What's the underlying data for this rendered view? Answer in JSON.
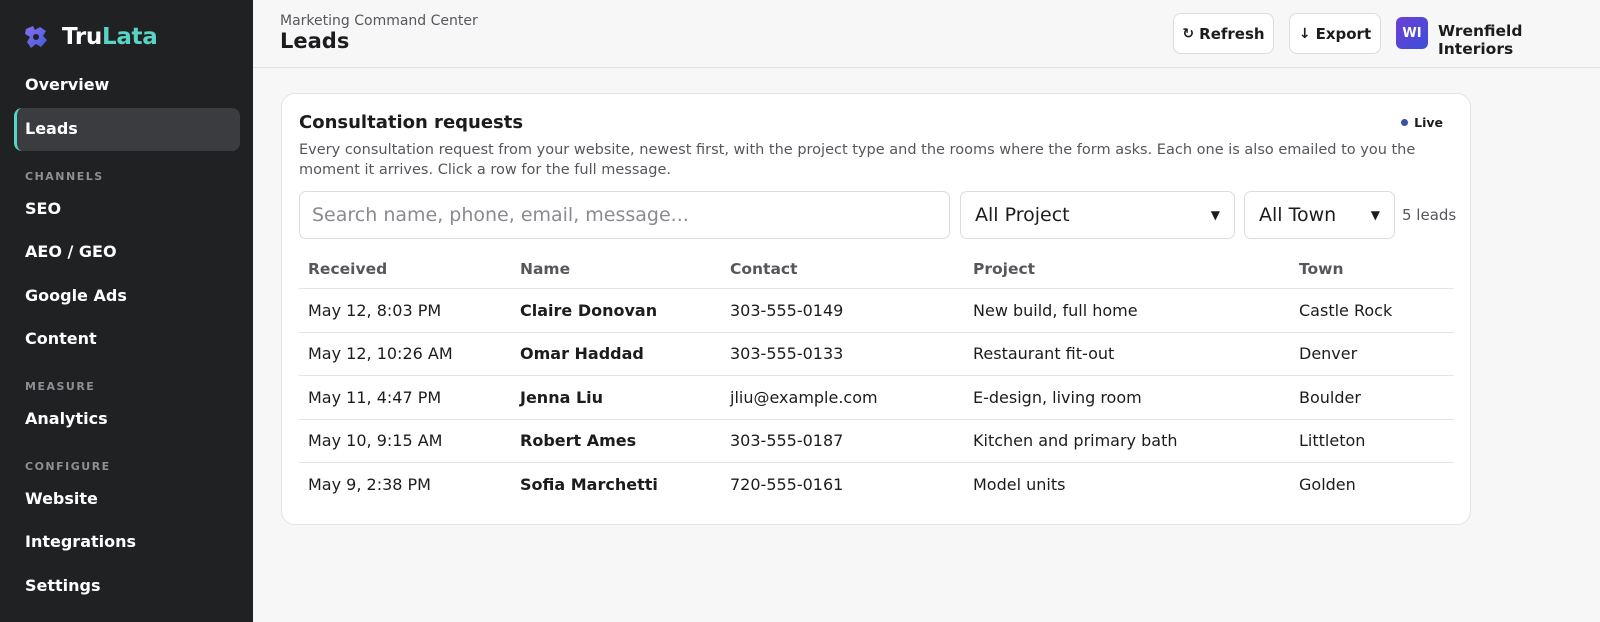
{
  "brand": {
    "name_part1": "Tru",
    "name_part2": "Lata",
    "accent": "#59d4c4"
  },
  "sidebar": {
    "items": [
      {
        "label": "Overview"
      },
      {
        "label": "Leads",
        "active": true
      },
      {
        "label": "SEO"
      },
      {
        "label": "AEO / GEO"
      },
      {
        "label": "Google Ads"
      },
      {
        "label": "Content"
      },
      {
        "label": "Analytics"
      },
      {
        "label": "Website"
      },
      {
        "label": "Integrations"
      },
      {
        "label": "Settings"
      }
    ],
    "sections": {
      "channels": "CHANNELS",
      "measure": "MEASURE",
      "configure": "CONFIGURE"
    }
  },
  "header": {
    "kicker": "Marketing Command Center",
    "title": "Leads",
    "refresh_label": "Refresh",
    "export_label": "Export",
    "avatar_initials": "WI",
    "org_name": "Wrenfield Interiors"
  },
  "card": {
    "title": "Consultation requests",
    "live_label": "Live",
    "description": "Every consultation request from your website, newest first, with the project type and the rooms where the form asks. Each one is also emailed to you the moment it arrives. Click a row for the full message.",
    "search_placeholder": "Search name, phone, email, message...",
    "project_filter": "All Project",
    "town_filter": "All Town",
    "count_label": "5 leads"
  },
  "table": {
    "columns": [
      "Received",
      "Name",
      "Contact",
      "Project",
      "Town"
    ],
    "rows": [
      [
        "May 12, 8:03 PM",
        "Claire Donovan",
        "303-555-0149",
        "New build, full home",
        "Castle Rock"
      ],
      [
        "May 12, 10:26 AM",
        "Omar Haddad",
        "303-555-0133",
        "Restaurant fit-out",
        "Denver"
      ],
      [
        "May 11, 4:47 PM",
        "Jenna Liu",
        "jliu@example.com",
        "E-design, living room",
        "Boulder"
      ],
      [
        "May 10, 9:15 AM",
        "Robert Ames",
        "303-555-0187",
        "Kitchen and primary bath",
        "Littleton"
      ],
      [
        "May 9, 2:38 PM",
        "Sofia Marchetti",
        "720-555-0161",
        "Model units",
        "Golden"
      ]
    ]
  }
}
